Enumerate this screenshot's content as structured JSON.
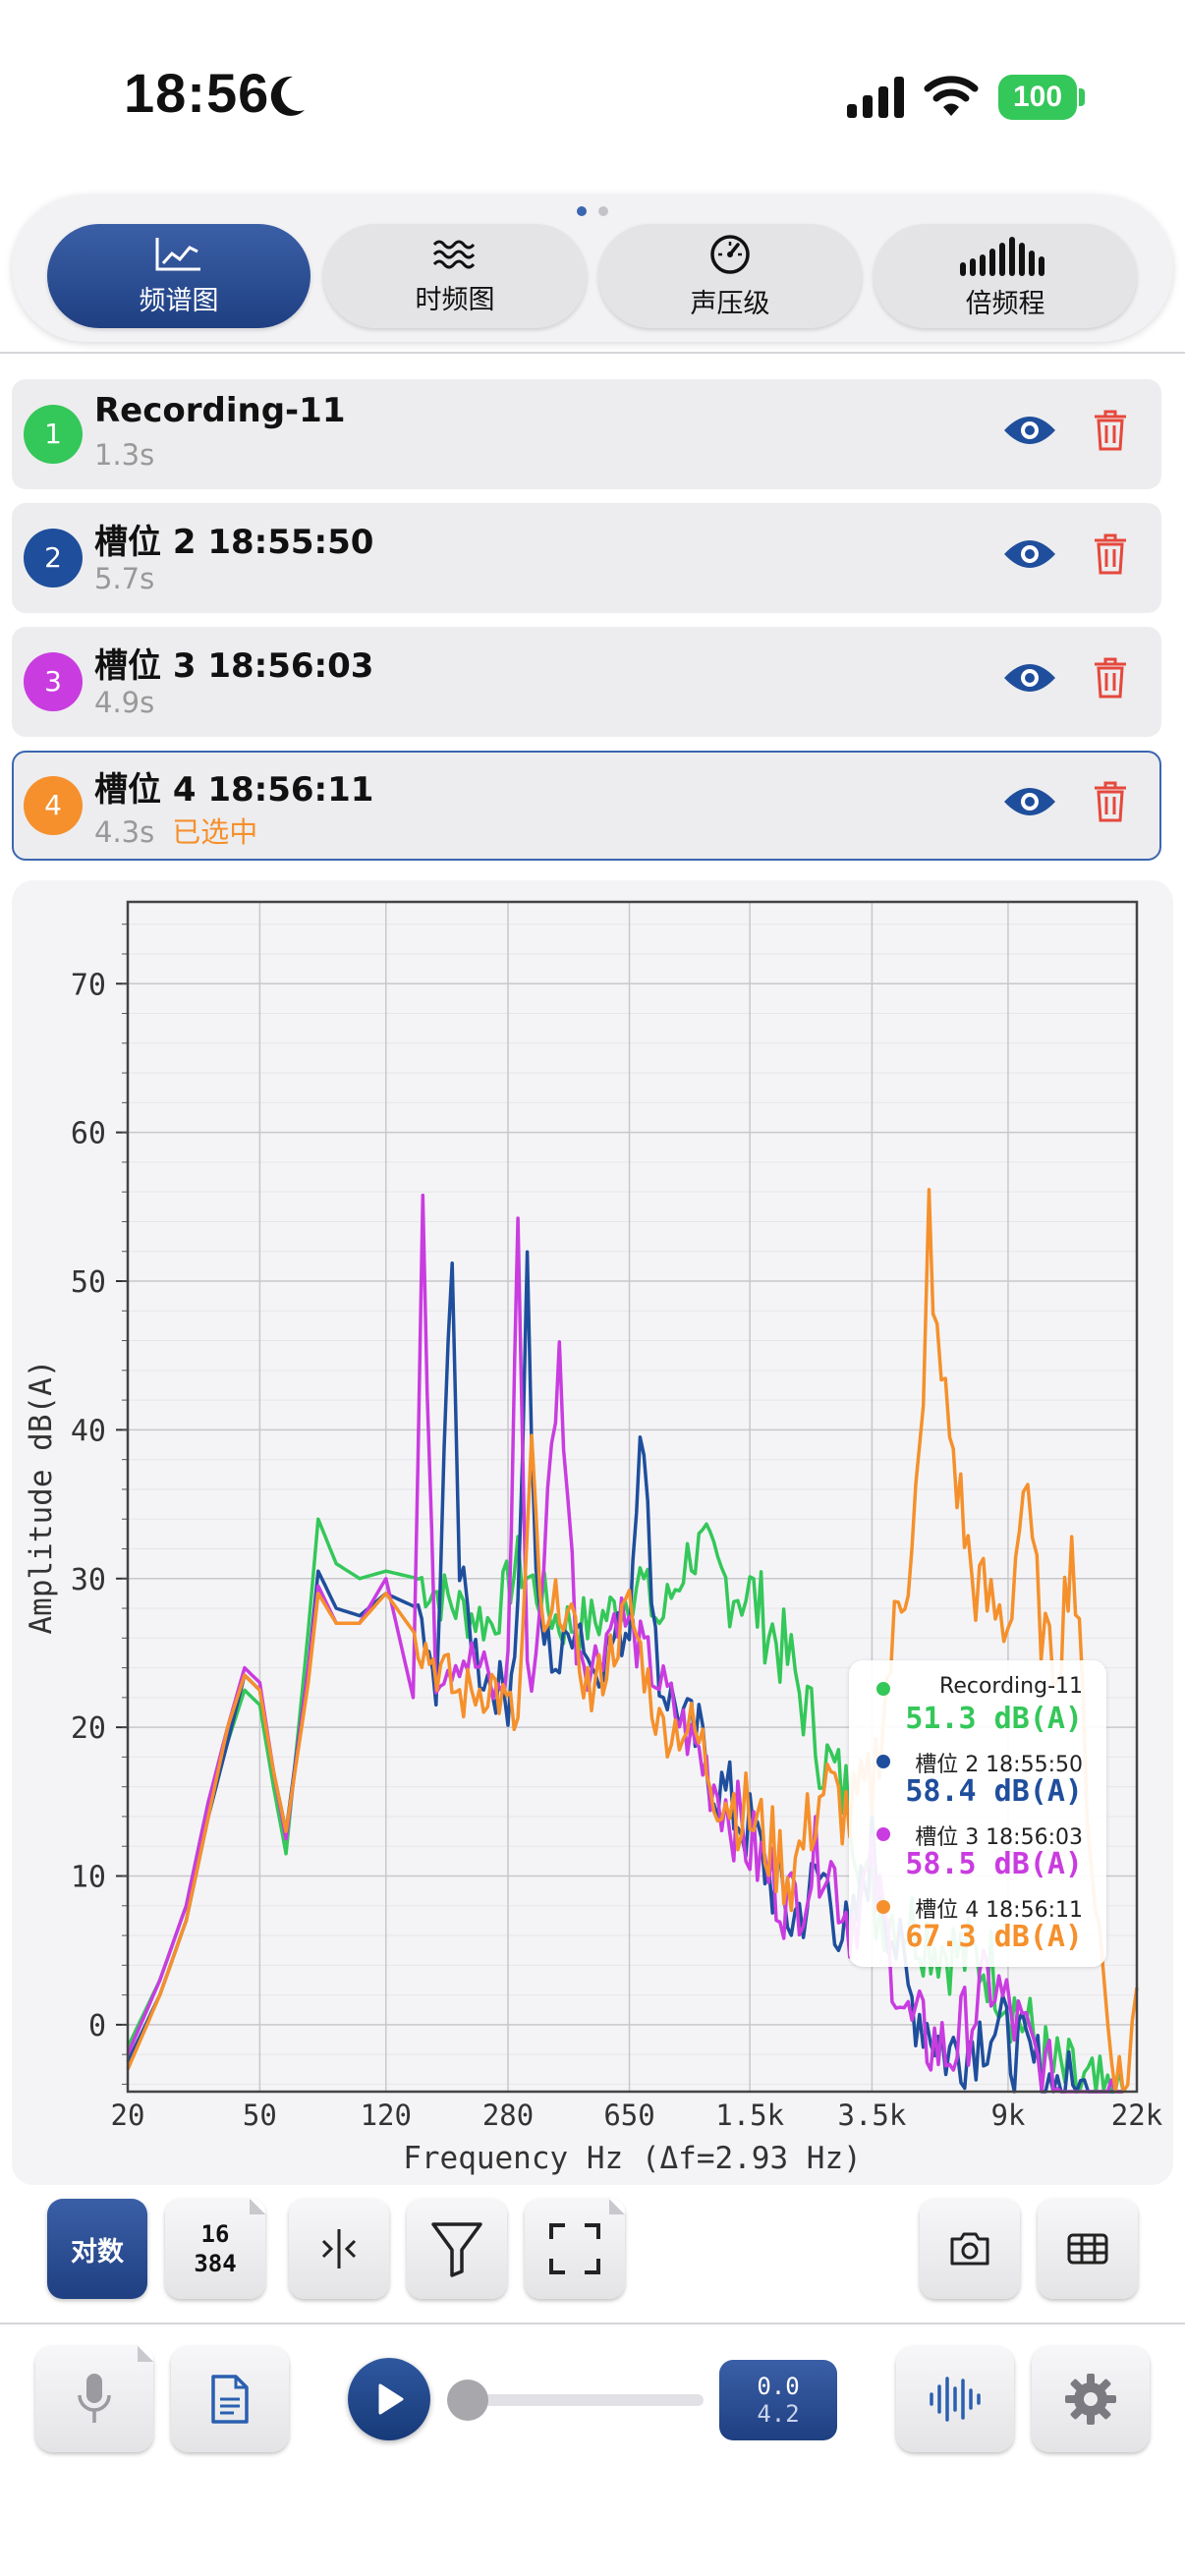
{
  "status_bar": {
    "time": "18:56",
    "battery": "100"
  },
  "tabs": [
    {
      "label": "频谱图",
      "icon": "spectrum-chart-icon",
      "active": true
    },
    {
      "label": "时频图",
      "icon": "waves-icon",
      "active": false
    },
    {
      "label": "声压级",
      "icon": "gauge-icon",
      "active": false
    },
    {
      "label": "倍频程",
      "icon": "octave-bars-icon",
      "active": false
    }
  ],
  "recordings": [
    {
      "num": "1",
      "title": "Recording-11",
      "duration": "1.3s",
      "color": "#34c759",
      "selected_label": ""
    },
    {
      "num": "2",
      "title": "槽位 2 18:55:50",
      "duration": "5.7s",
      "color": "#1f4e9c",
      "selected_label": ""
    },
    {
      "num": "3",
      "title": "槽位 3 18:56:03",
      "duration": "4.9s",
      "color": "#c93ce0",
      "selected_label": ""
    },
    {
      "num": "4",
      "title": "槽位 4 18:56:11",
      "duration": "4.3s",
      "color": "#f5902c",
      "selected_label": "已选中"
    }
  ],
  "chart_data": {
    "type": "line",
    "xlabel": "Frequency Hz (Δf=2.93 Hz)",
    "ylabel": "Amplitude dB(A)",
    "x_scale": "log",
    "x_ticks": [
      "20",
      "50",
      "120",
      "280",
      "650",
      "1.5k",
      "3.5k",
      "9k",
      "22k"
    ],
    "x_tick_values": [
      20,
      50,
      120,
      280,
      650,
      1500,
      3500,
      9000,
      22000
    ],
    "y_ticks": [
      "0",
      "10",
      "20",
      "30",
      "40",
      "50",
      "60",
      "70"
    ],
    "ylim": [
      -4.5,
      75.5
    ],
    "xlim": [
      20,
      22000
    ],
    "grid": true,
    "series": [
      {
        "name": "Recording-11",
        "color": "#34c759",
        "x": [
          20,
          25,
          30,
          35,
          40,
          45,
          50,
          55,
          60,
          70,
          75,
          85,
          100,
          120,
          150,
          200,
          250,
          300,
          400,
          500,
          600,
          700,
          800,
          1000,
          1200,
          1500,
          1800,
          2000,
          2500,
          3000,
          3500,
          4500,
          6000,
          8000,
          12000,
          20000
        ],
        "y": [
          -1.5,
          3,
          8,
          15,
          19,
          22.5,
          21.5,
          16,
          11.5,
          26.5,
          34,
          31,
          30,
          30.5,
          30,
          28,
          27,
          31,
          27,
          27,
          28,
          30,
          27,
          32,
          30,
          29,
          26,
          24,
          18,
          15,
          8,
          7,
          5,
          4,
          -3,
          -6
        ]
      },
      {
        "name": "槽位 2 18:55:50",
        "color": "#1f4e9c",
        "x": [
          20,
          25,
          30,
          35,
          40,
          45,
          50,
          55,
          60,
          70,
          75,
          85,
          100,
          120,
          150,
          170,
          190,
          200,
          230,
          280,
          300,
          320,
          340,
          360,
          400,
          450,
          500,
          650,
          700,
          800,
          1000,
          1200,
          1500,
          2000,
          2500,
          3000,
          3500,
          4500,
          6000,
          8000,
          12000,
          20000
        ],
        "y": [
          -2.5,
          2,
          7,
          14,
          19,
          23.5,
          22.5,
          17,
          13,
          24,
          30.5,
          28,
          27.5,
          29,
          28,
          21.5,
          53,
          30,
          24,
          22,
          28,
          51,
          29,
          26,
          24,
          28,
          24,
          27,
          41,
          23,
          20,
          16,
          13,
          7,
          10,
          5,
          12,
          2,
          -2,
          0,
          -4,
          -6
        ]
      },
      {
        "name": "槽位 3 18:56:03",
        "color": "#c93ce0",
        "x": [
          20,
          25,
          30,
          35,
          40,
          45,
          50,
          55,
          60,
          70,
          75,
          85,
          100,
          120,
          135,
          145,
          155,
          170,
          200,
          230,
          260,
          280,
          300,
          320,
          340,
          400,
          450,
          500,
          600,
          800,
          1000,
          1200,
          1500,
          2000,
          2500,
          3000,
          3500,
          4500,
          6000,
          8000,
          12000,
          20000
        ],
        "y": [
          -2,
          3,
          8,
          15,
          20,
          24,
          23,
          17,
          12.5,
          24,
          29.5,
          27,
          27,
          30,
          25,
          22,
          54,
          24,
          25,
          24,
          22,
          24,
          54.5,
          23,
          25,
          45,
          26,
          24,
          28,
          23,
          19,
          16,
          12,
          8,
          12,
          7,
          10,
          0,
          -2,
          3,
          -4,
          -5
        ]
      },
      {
        "name": "槽位 4 18:56:11",
        "color": "#f5902c",
        "x": [
          20,
          25,
          30,
          35,
          40,
          45,
          50,
          55,
          60,
          70,
          75,
          85,
          100,
          120,
          150,
          200,
          250,
          300,
          330,
          360,
          400,
          500,
          650,
          800,
          1000,
          1200,
          1500,
          2000,
          2500,
          3000,
          3500,
          4200,
          4500,
          5000,
          5200,
          5500,
          6000,
          7000,
          8000,
          9000,
          10000,
          11000,
          12000,
          13000,
          14000,
          16000,
          18000,
          20000,
          22000
        ],
        "y": [
          -3,
          2,
          7,
          14,
          20,
          23.5,
          22.5,
          17,
          13,
          23,
          29,
          27,
          27,
          29,
          26,
          22,
          23,
          20,
          38,
          25,
          29,
          22,
          28,
          20,
          20,
          16,
          14,
          10,
          16,
          14,
          16,
          28,
          31,
          40,
          55,
          45,
          40,
          30,
          28,
          27,
          36,
          29,
          24,
          26,
          33,
          12,
          0,
          -5,
          2.5
        ]
      }
    ]
  },
  "legend": [
    {
      "name": "Recording-11",
      "value": "51.3 dB(A)",
      "color": "#34c759"
    },
    {
      "name": "槽位 2 18:55:50",
      "value": "58.4 dB(A)",
      "color": "#1f4e9c"
    },
    {
      "name": "槽位 3 18:56:03",
      "value": "58.5 dB(A)",
      "color": "#c93ce0"
    },
    {
      "name": "槽位 4 18:56:11",
      "value": "67.3 dB(A)",
      "color": "#f5902c"
    }
  ],
  "toolbar": {
    "log_label": "对数",
    "fft_size_top": "16",
    "fft_size_bottom": "384"
  },
  "playback": {
    "time_current": "0.0",
    "time_total": "4.2",
    "progress": 0.0
  }
}
